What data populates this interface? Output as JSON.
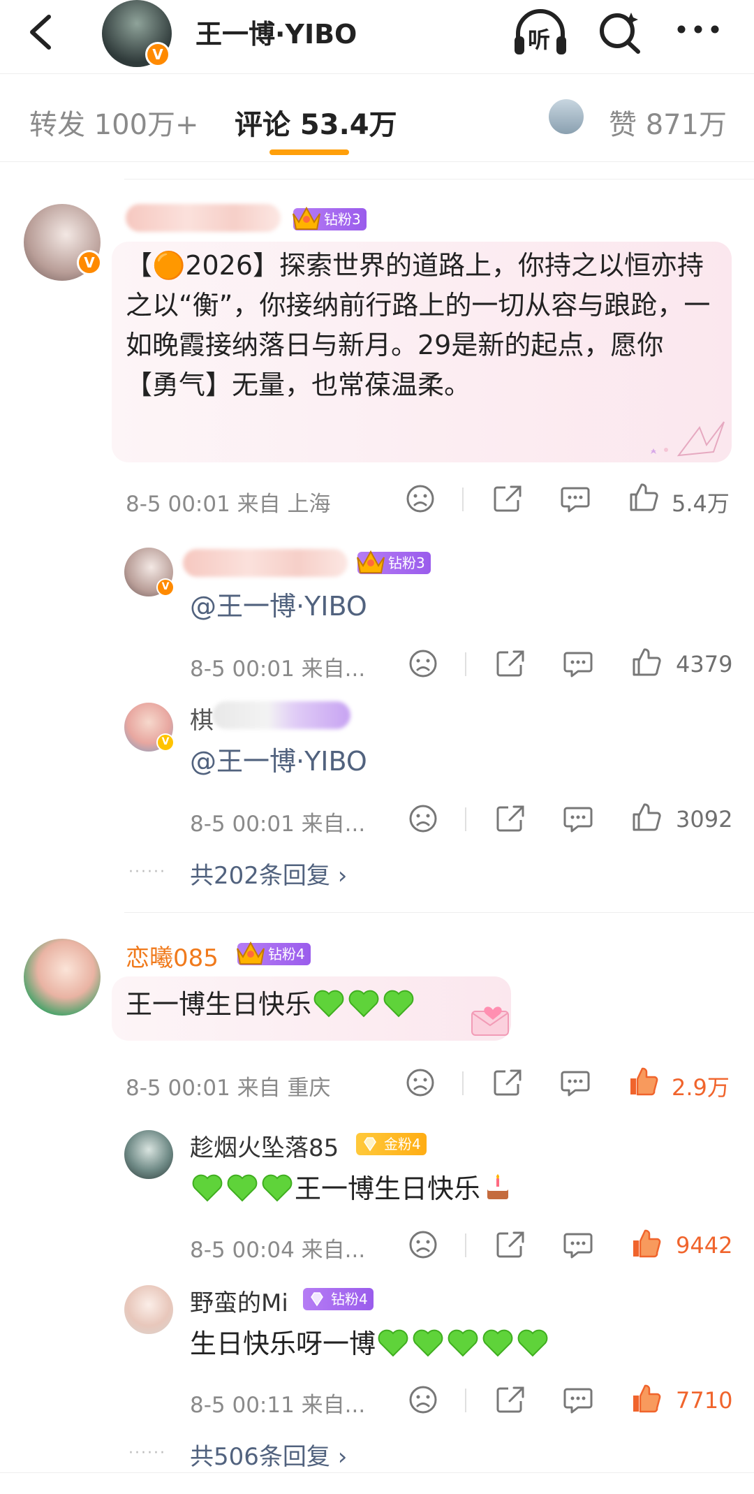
{
  "header": {
    "title": "王一博·YIBO",
    "back_icon": "chevron-left-icon",
    "listen_label": "听",
    "icons": [
      "headphones-icon",
      "search-icon",
      "more-icon"
    ]
  },
  "tabs": {
    "repost": "转发 100万+",
    "comments": "评论 53.4万",
    "likes": "赞 871万"
  },
  "colors": {
    "accent": "#ff9f0a",
    "like_active": "#f0642c",
    "link": "#51627e",
    "badge_purple": "#9a5cec",
    "badge_gold": "#ffad14"
  },
  "comments": [
    {
      "badge": "钻粉3",
      "text": "【🟠2026】探索世界的道路上，你持之以恒亦持之以“衡”，你接纳前行路上的一切从容与踉跄，一如晚霞接纳落日与新月。29是新的起点，愿你【勇气】无量，也常葆温柔。",
      "meta": "8-5 00:01 来自 上海",
      "likes": "5.4万",
      "replies": [
        {
          "badge": "钻粉3",
          "text": "@王一博·YIBO",
          "meta": "8-5 00:01 来自...",
          "likes": "4379"
        },
        {
          "name_visible": "棋",
          "text": "@王一博·YIBO",
          "meta": "8-5 00:01 来自...",
          "likes": "3092"
        }
      ],
      "more_replies": "共202条回复 ›",
      "dots": "······"
    },
    {
      "name": "恋曦085",
      "badge": "钻粉4",
      "text": "王一博生日快乐",
      "meta": "8-5 00:01 来自 重庆",
      "likes": "2.9万",
      "replies": [
        {
          "name": "趁烟火坠落85",
          "badge": "金粉4",
          "text_after": "王一博生日快乐",
          "meta": "8-5 00:04 来自...",
          "likes": "9442"
        },
        {
          "name": "野蛮的Mi",
          "badge": "钻粉4",
          "text": "生日快乐呀一博",
          "meta": "8-5 00:11 来自...",
          "likes": "7710"
        }
      ],
      "more_replies": "共506条回复 ›",
      "dots": "······"
    }
  ]
}
